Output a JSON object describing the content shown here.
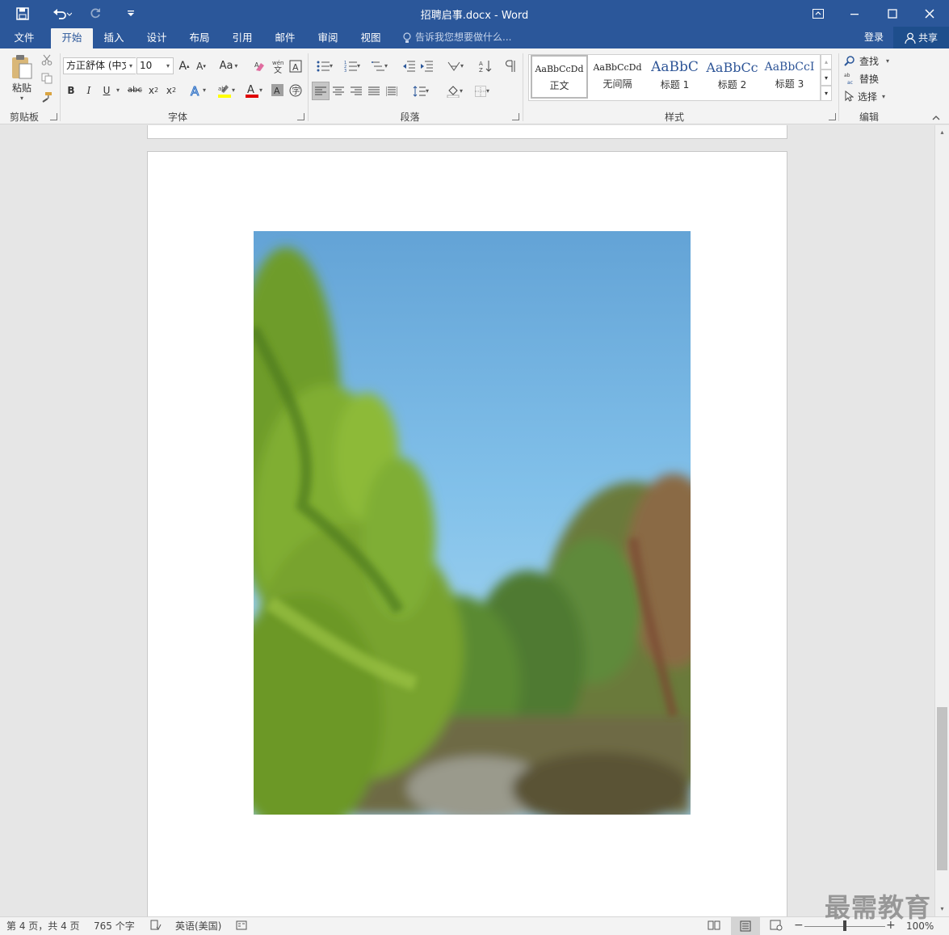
{
  "window": {
    "title": "招聘启事.docx - Word",
    "colors": {
      "brand": "#2b579a",
      "ribbon_bg": "#f3f3f3",
      "status_bg": "#f3f3f3"
    }
  },
  "tabs": [
    {
      "label": "文件",
      "active": false
    },
    {
      "label": "开始",
      "active": true
    },
    {
      "label": "插入",
      "active": false
    },
    {
      "label": "设计",
      "active": false
    },
    {
      "label": "布局",
      "active": false
    },
    {
      "label": "引用",
      "active": false
    },
    {
      "label": "邮件",
      "active": false
    },
    {
      "label": "审阅",
      "active": false
    },
    {
      "label": "视图",
      "active": false
    }
  ],
  "tell_me": {
    "placeholder": "告诉我您想要做什么..."
  },
  "account": {
    "sign_in": "登录",
    "share": "共享"
  },
  "clipboard": {
    "paste_label": "粘贴",
    "group_label": "剪贴板"
  },
  "font": {
    "name": "方正舒体 (中文",
    "size": "10",
    "group_label": "字体",
    "change_case": "Aa"
  },
  "paragraph": {
    "group_label": "段落"
  },
  "styles": {
    "group_label": "样式",
    "items": [
      {
        "sample": "AaBbCcDd",
        "label": "正文",
        "selected": true
      },
      {
        "sample": "AaBbCcDd",
        "label": "无间隔",
        "selected": false
      },
      {
        "sample": "AaBbC",
        "label": "标题 1",
        "selected": false
      },
      {
        "sample": "AaBbCc",
        "label": "标题 2",
        "selected": false
      },
      {
        "sample": "AaBbCcI",
        "label": "标题 3",
        "selected": false
      }
    ]
  },
  "editing": {
    "find": "查找",
    "replace": "替换",
    "select": "选择",
    "group_label": "编辑"
  },
  "status": {
    "page": "第 4 页，共 4 页",
    "words": "765 个字",
    "language": "英语(美国)",
    "zoom": "100%",
    "zoom_level": 1.0
  },
  "watermark": "最需教育"
}
